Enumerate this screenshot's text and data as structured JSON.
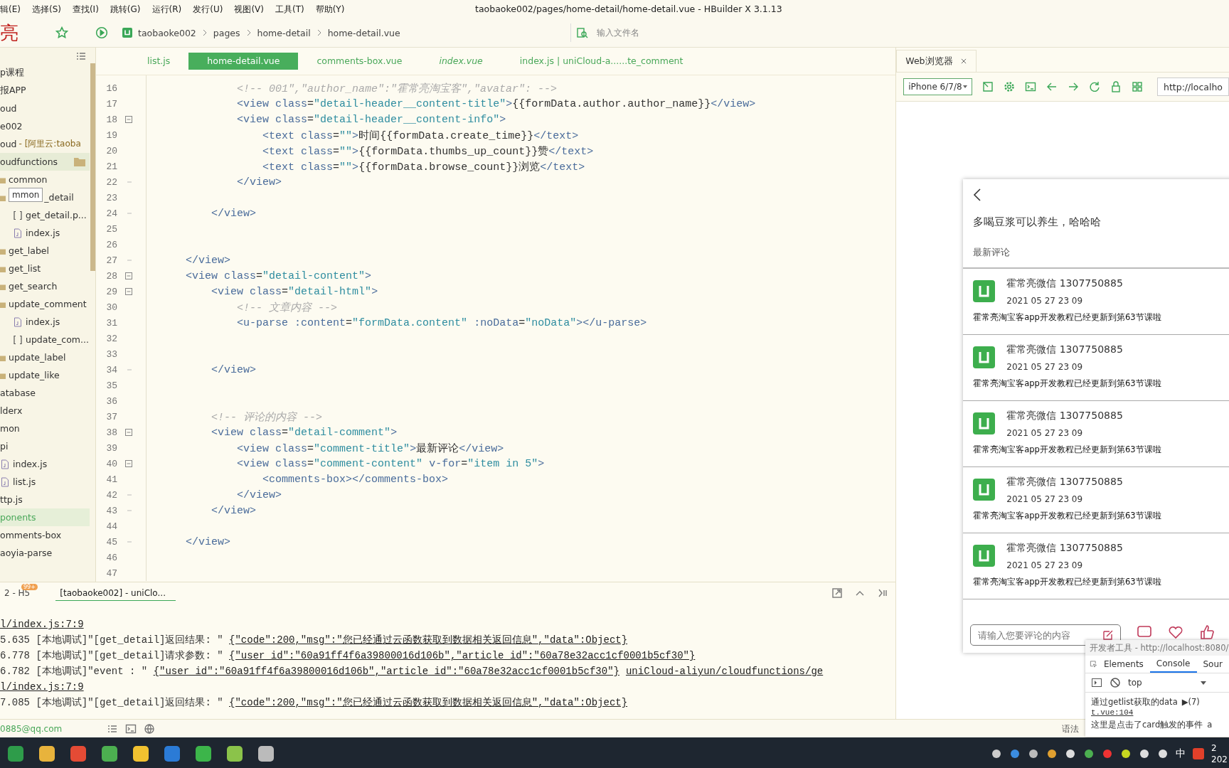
{
  "menu_bar": {
    "items": [
      "辑(E)",
      "选择(S)",
      "查找(I)",
      "跳转(G)",
      "运行(R)",
      "发行(U)",
      "视图(V)",
      "工具(T)",
      "帮助(Y)"
    ],
    "title": "taobaoke002/pages/home-detail/home-detail.vue - HBuilder X 3.1.13"
  },
  "toolbar": {
    "logo": "亮",
    "breadcrumb": [
      "taobaoke002",
      "pages",
      "home-detail",
      "home-detail.vue"
    ],
    "search": {
      "placeholder": "输入文件名"
    }
  },
  "sidebar": {
    "items": [
      {
        "label": "p课程",
        "selected": false,
        "hovered": false
      },
      {
        "label": "报APP",
        "selected": false,
        "hovered": false
      },
      {
        "label": "oud",
        "selected": false,
        "hovered": false
      },
      {
        "label": "e002",
        "selected": false,
        "hovered": false
      },
      {
        "label": "oud",
        "suffix": "- [阿里云:taoba",
        "selected": false,
        "hovered": false
      },
      {
        "label": "oudfunctions",
        "selected": false,
        "hovered": true,
        "children": [
          {
            "label": "common",
            "kind": "folder",
            "selected": false,
            "hovered": false
          },
          {
            "label": "_detail",
            "tooltip": "mmon",
            "kind": "folder",
            "selected": false,
            "hovered": false,
            "children": [
              {
                "label": "get_detail.p...",
                "kind": "json",
                "selected": false,
                "hovered": false
              },
              {
                "label": "index.js",
                "kind": "js",
                "selected": false,
                "hovered": false
              }
            ]
          },
          {
            "label": "get_label",
            "kind": "folder",
            "selected": false,
            "hovered": false
          },
          {
            "label": "get_list",
            "kind": "folder",
            "selected": false,
            "hovered": false
          },
          {
            "label": "get_search",
            "kind": "folder",
            "selected": false,
            "hovered": false
          },
          {
            "label": "update_comment",
            "kind": "folder",
            "selected": false,
            "hovered": false,
            "children": [
              {
                "label": "index.js",
                "kind": "js",
                "selected": false,
                "hovered": false
              },
              {
                "label": "update_com...",
                "kind": "json",
                "selected": false,
                "hovered": false
              }
            ]
          },
          {
            "label": "update_label",
            "kind": "folder",
            "selected": false,
            "hovered": false
          },
          {
            "label": "update_like",
            "kind": "folder",
            "selected": false,
            "hovered": false
          }
        ]
      },
      {
        "label": "atabase",
        "selected": false,
        "hovered": false
      },
      {
        "label": "lderx",
        "selected": false,
        "hovered": false
      },
      {
        "label": "mon",
        "selected": false,
        "hovered": false
      },
      {
        "label": "pi",
        "selected": false,
        "hovered": false,
        "children": [
          {
            "label": "index.js",
            "kind": "js",
            "selected": false,
            "hovered": false
          },
          {
            "label": "list.js",
            "kind": "js",
            "selected": false,
            "hovered": false
          }
        ]
      },
      {
        "label": "ttp.js",
        "selected": false,
        "hovered": false
      },
      {
        "label": "ponents",
        "selected": true,
        "hovered": false
      },
      {
        "label": "omments-box",
        "selected": false,
        "hovered": false
      },
      {
        "label": "aoyia-parse",
        "selected": false,
        "hovered": false
      }
    ]
  },
  "editor": {
    "tabs": [
      {
        "label": "list.js",
        "selected": false,
        "preview": false
      },
      {
        "label": "home-detail.vue",
        "selected": true,
        "preview": false
      },
      {
        "label": "comments-box.vue",
        "selected": false,
        "preview": false
      },
      {
        "label": "index.vue",
        "selected": false,
        "preview": true
      },
      {
        "label": "index.js | uniCloud-a......te_comment",
        "selected": false,
        "preview": false
      }
    ],
    "lines": [
      {
        "num": "16",
        "kind": "comment",
        "text": "                <!-- 001\",\"author_name\":\"霍常亮淘宝客\",\"avatar\": -->"
      },
      {
        "num": "17",
        "kind": "code",
        "text": "                <view class=\"detail-header__content-title\">{{formData.author.author_name}}</view>"
      },
      {
        "num": "18",
        "kind": "fold",
        "text": "                <view class=\"detail-header__content-info\">"
      },
      {
        "num": "19",
        "kind": "code",
        "text": "                    <text class=\"\">时间{{formData.create_time}}</text>"
      },
      {
        "num": "20",
        "kind": "code",
        "text": "                    <text class=\"\">{{formData.thumbs_up_count}}赞</text>"
      },
      {
        "num": "21",
        "kind": "code",
        "text": "                    <text class=\"\">{{formData.browse_count}}浏览</text>"
      },
      {
        "num": "22",
        "kind": "fold-end",
        "text": "                </view>"
      },
      {
        "num": "23"
      },
      {
        "num": "24",
        "kind": "fold-end",
        "text": "            </view>"
      },
      {
        "num": "25"
      },
      {
        "num": "26"
      },
      {
        "num": "27",
        "kind": "fold-end",
        "text": "        </view>"
      },
      {
        "num": "28",
        "kind": "fold",
        "text": "        <view class=\"detail-content\">"
      },
      {
        "num": "29",
        "kind": "fold",
        "text": "            <view class=\"detail-html\">"
      },
      {
        "num": "30",
        "kind": "comment",
        "text": "                <!-- 文章内容 -->"
      },
      {
        "num": "31",
        "kind": "code",
        "text": "                <u-parse :content=\"formData.content\" :noData=\"noData\"></u-parse>"
      },
      {
        "num": "32"
      },
      {
        "num": "33"
      },
      {
        "num": "34",
        "kind": "fold-end",
        "text": "            </view>"
      },
      {
        "num": "35"
      },
      {
        "num": "36"
      },
      {
        "num": "37",
        "kind": "comment",
        "text": "            <!-- 评论的内容 -->"
      },
      {
        "num": "38",
        "kind": "fold",
        "text": "            <view class=\"detail-comment\">"
      },
      {
        "num": "39",
        "kind": "code",
        "text": "                <view class=\"comment-title\">最新评论</view>"
      },
      {
        "num": "40",
        "kind": "fold",
        "text": "                <view class=\"comment-content\" v-for=\"item in 5\">"
      },
      {
        "num": "41",
        "kind": "code",
        "text": "                    <comments-box></comments-box>"
      },
      {
        "num": "42",
        "kind": "fold-end",
        "text": "                </view>"
      },
      {
        "num": "43",
        "kind": "fold-end",
        "text": "            </view>"
      },
      {
        "num": "44"
      },
      {
        "num": "45",
        "kind": "fold-end",
        "text": "        </view>"
      },
      {
        "num": "46"
      },
      {
        "num": "47"
      }
    ]
  },
  "console": {
    "tabs": [
      {
        "label": "2 - H5",
        "badge": "99+",
        "selected": false
      },
      {
        "label": "[taobaoke002] - uniClo...",
        "selected": true
      }
    ],
    "lines": [
      [
        {
          "text": "l/index.js:7:9",
          "link": true
        }
      ],
      [
        {
          "text": "5.635 [本地调试]\"[get_detail]返回结果: \" ",
          "link": false
        },
        {
          "text": "{\"code\":200,\"msg\":\"您已经通过云函数获取到数据相关返回信息\",\"data\":Object}",
          "link": true
        }
      ],
      [
        {
          "text": "6.778 [本地调试]\"[get_detail]请求参数: \" ",
          "link": false
        },
        {
          "text": "{\"user_id\":\"60a91ff4f6a39800016d106b\",\"article_id\":\"60a78e32acc1cf0001b5cf30\"}",
          "link": true
        }
      ],
      [
        {
          "text": "6.782 [本地调试]\"event : \" ",
          "link": false
        },
        {
          "text": "{\"user_id\":\"60a91ff4f6a39800016d106b\",\"article_id\":\"60a78e32acc1cf0001b5cf30\"}",
          "link": true
        },
        {
          "text": "uniCloud-aliyun/cloudfunctions/ge",
          "link": true
        }
      ],
      [
        {
          "text": "l/index.js:7:9",
          "link": true
        }
      ],
      [
        {
          "text": "7.085 [本地调试]\"[get_detail]返回结果: \" ",
          "link": false
        },
        {
          "text": "{\"code\":200,\"msg\":\"您已经通过云函数获取到数据相关返回信息\",\"data\":Object}",
          "link": true
        }
      ]
    ]
  },
  "status_bar": {
    "account": "0885@qq.com",
    "syntax": "语法"
  },
  "browser": {
    "tab": "Web浏览器",
    "device": "iPhone 6/7/8",
    "url": "http://localho",
    "page": {
      "title": "多喝豆浆可以养生，哈哈哈",
      "section": "最新评论",
      "comments": [
        {
          "name": "霍常亮微信 1307750885",
          "date": "2021 05 27 23 09",
          "text": "霍常亮淘宝客app开发教程已经更新到第63节课啦"
        },
        {
          "name": "霍常亮微信 1307750885",
          "date": "2021 05 27 23 09",
          "text": "霍常亮淘宝客app开发教程已经更新到第63节课啦"
        },
        {
          "name": "霍常亮微信 1307750885",
          "date": "2021 05 27 23 09",
          "text": "霍常亮淘宝客app开发教程已经更新到第63节课啦"
        },
        {
          "name": "霍常亮微信 1307750885",
          "date": "2021 05 27 23 09",
          "text": "霍常亮淘宝客app开发教程已经更新到第63节课啦"
        },
        {
          "name": "霍常亮微信 1307750885",
          "date": "2021 05 27 23 09",
          "text": "霍常亮淘宝客app开发教程已经更新到第63节课啦"
        }
      ],
      "input": {
        "placeholder": "请输入您要评论的内容"
      }
    }
  },
  "devtools": {
    "title": "开发者工具 - http://localhost:8080/",
    "tabs": [
      {
        "label": "Elements",
        "selected": false
      },
      {
        "label": "Console",
        "selected": true
      },
      {
        "label": "Sour",
        "selected": false
      }
    ],
    "context": "top",
    "logs": [
      {
        "text": "通过getlist获取的data",
        "extra": "▶(7)"
      },
      {
        "source": "t.vue:104"
      },
      {
        "text": "这里是点击了card触发的事件",
        "extra": "a"
      }
    ]
  },
  "taskbar": {
    "ime": "中",
    "clock": [
      "2",
      "202"
    ]
  }
}
